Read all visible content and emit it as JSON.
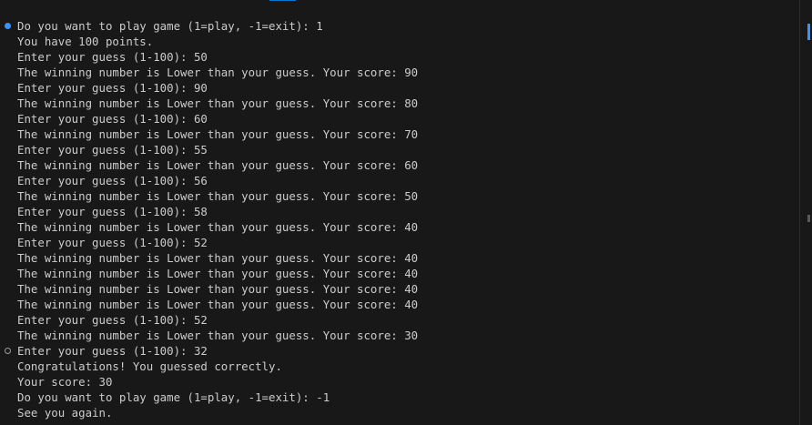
{
  "terminal": {
    "lines": [
      "Do you want to play game (1=play, -1=exit): 1",
      "You have 100 points.",
      "Enter your guess (1-100): 50",
      "The winning number is Lower than your guess. Your score: 90",
      "Enter your guess (1-100): 90",
      "The winning number is Lower than your guess. Your score: 80",
      "Enter your guess (1-100): 60",
      "The winning number is Lower than your guess. Your score: 70",
      "Enter your guess (1-100): 55",
      "The winning number is Lower than your guess. Your score: 60",
      "Enter your guess (1-100): 56",
      "The winning number is Lower than your guess. Your score: 50",
      "Enter your guess (1-100): 58",
      "The winning number is Lower than your guess. Your score: 40",
      "Enter your guess (1-100): 52",
      "The winning number is Lower than your guess. Your score: 40",
      "The winning number is Lower than your guess. Your score: 40",
      "The winning number is Lower than your guess. Your score: 40",
      "The winning number is Lower than your guess. Your score: 40",
      "Enter your guess (1-100): 52",
      "The winning number is Lower than your guess. Your score: 30",
      "Enter your guess (1-100): 32",
      "Congratulations! You guessed correctly.",
      "Your score: 30",
      "Do you want to play game (1=play, -1=exit): -1",
      "See you again."
    ],
    "command_markers": [
      {
        "line": 0,
        "state": "success"
      },
      {
        "line": 21,
        "state": "default"
      }
    ]
  },
  "colors": {
    "background": "#181818",
    "text": "#cccccc",
    "accent": "#3794ff",
    "marker_default": "#9d9d9d"
  }
}
